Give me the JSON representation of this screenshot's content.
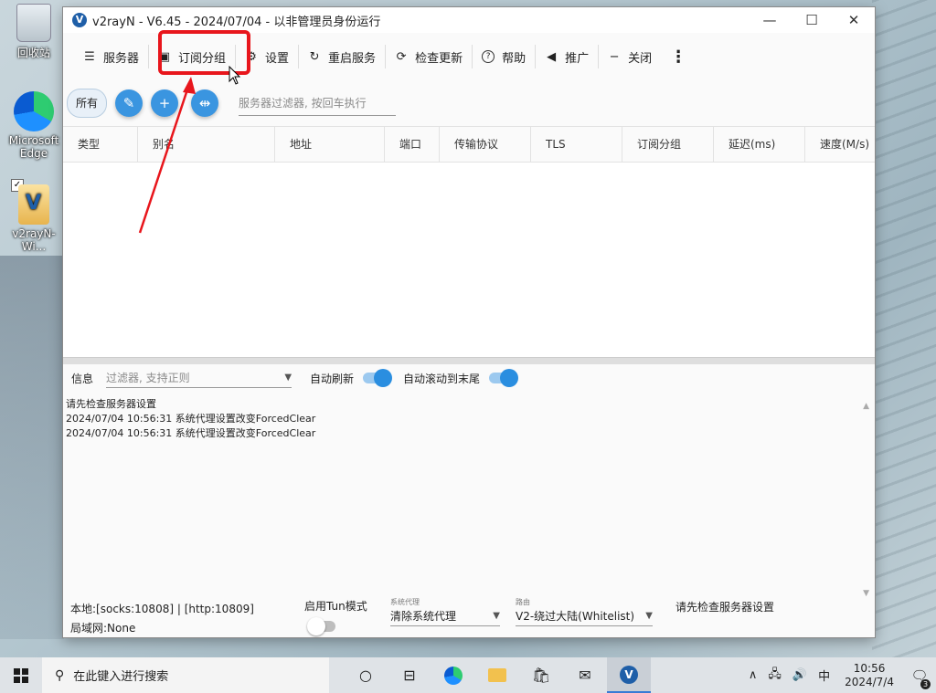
{
  "desktop": {
    "icons": [
      {
        "label": "回收站"
      },
      {
        "label": "Microsoft Edge"
      },
      {
        "label": "v2rayN-Wi..."
      }
    ]
  },
  "window": {
    "title": "v2rayN - V6.45 - 2024/07/04 - 以非管理员身份运行",
    "controls": {
      "minimize": "—",
      "maximize": "☐",
      "close": "✕"
    }
  },
  "toolbar": {
    "items": [
      {
        "label": "服务器",
        "icon": "server-icon",
        "glyph": "☰"
      },
      {
        "label": "订阅分组",
        "icon": "subscription-icon",
        "glyph": "▣"
      },
      {
        "label": "设置",
        "icon": "gear-icon",
        "glyph": "⚙"
      },
      {
        "label": "重启服务",
        "icon": "restart-icon",
        "glyph": "↻"
      },
      {
        "label": "检查更新",
        "icon": "update-icon",
        "glyph": "⟳"
      },
      {
        "label": "帮助",
        "icon": "help-icon",
        "glyph": "?"
      },
      {
        "label": "推广",
        "icon": "speaker-icon",
        "glyph": "◀"
      },
      {
        "label": "关闭",
        "icon": "minus-icon",
        "glyph": "−"
      }
    ],
    "more_glyph": "⋮"
  },
  "filterbar": {
    "all_chip": "所有",
    "edit_glyph": "✎",
    "add_glyph": "+",
    "split_glyph": "⇹",
    "server_filter_placeholder": "服务器过滤器, 按回车执行"
  },
  "table": {
    "columns": [
      "类型",
      "别名",
      "地址",
      "端口",
      "传输协议",
      "TLS",
      "订阅分组",
      "延迟(ms)",
      "速度(M/s)"
    ],
    "rows": []
  },
  "log": {
    "label": "信息",
    "filter_placeholder": "过滤器, 支持正则",
    "auto_refresh_label": "自动刷新",
    "auto_scroll_label": "自动滚动到末尾",
    "auto_refresh": true,
    "auto_scroll": true,
    "lines": [
      "请先检查服务器设置",
      "2024/07/04 10:56:31 系统代理设置改变ForcedClear",
      "2024/07/04 10:56:31 系统代理设置改变ForcedClear"
    ]
  },
  "statusbar": {
    "local": "本地:[socks:10808] | [http:10809]",
    "lan": "局域网:None",
    "tun_label": "启用Tun模式",
    "tun_enabled": false,
    "proxy_caption": "系统代理",
    "proxy_value": "清除系统代理",
    "route_caption": "路由",
    "route_value": "V2-绕过大陆(Whitelist)",
    "message": "请先检查服务器设置"
  },
  "taskbar": {
    "search_placeholder": "在此键入进行搜索",
    "tray": {
      "ime": "中",
      "time": "10:56",
      "date": "2024/7/4",
      "notifications": "3"
    }
  },
  "colors": {
    "accent": "#3a95e0",
    "highlight": "#e8161c"
  }
}
